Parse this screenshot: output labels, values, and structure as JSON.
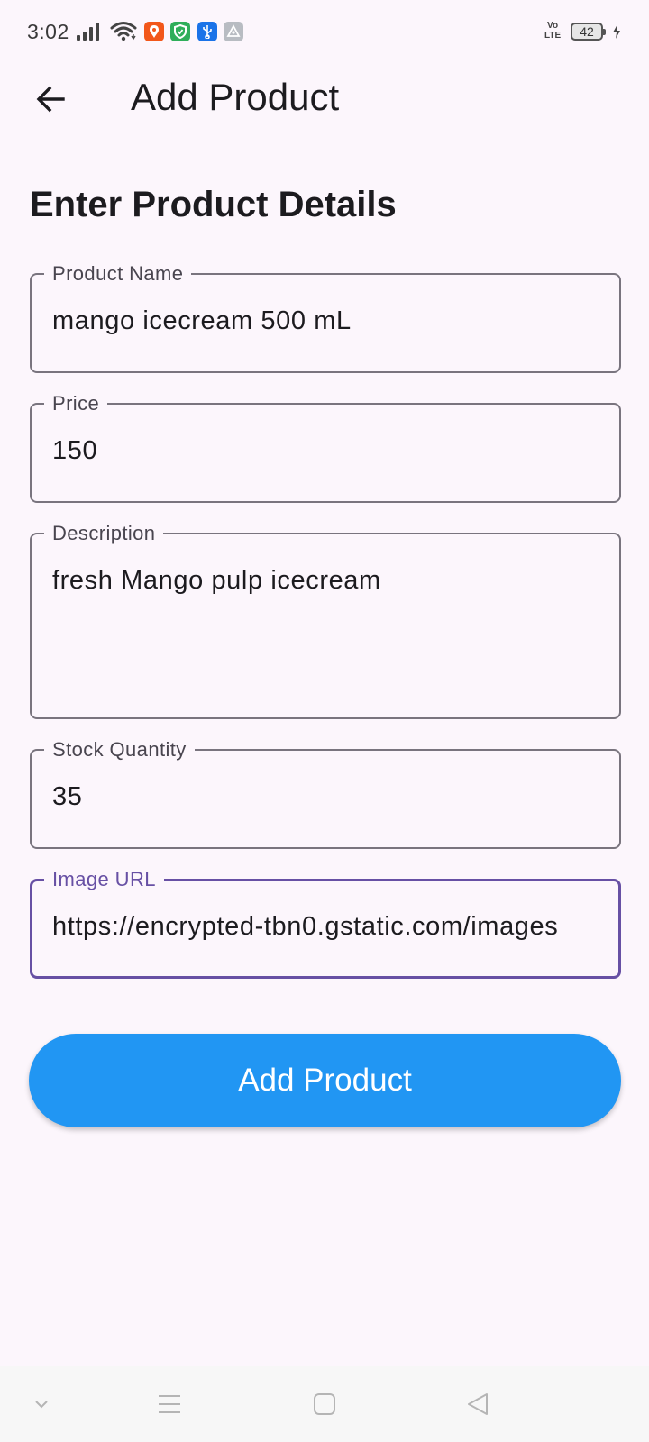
{
  "status_bar": {
    "time": "3:02",
    "battery_level": "42",
    "network_label_top": "Vo",
    "network_label_bottom": "LTE",
    "icons": [
      "signal-icon",
      "wifi-icon",
      "app-notification-orange-icon",
      "app-notification-green-shield-icon",
      "usb-icon",
      "app-notification-grey-icon",
      "charging-icon"
    ]
  },
  "app_bar": {
    "title": "Add Product",
    "back_icon": "arrow-back-icon"
  },
  "form": {
    "heading": "Enter Product Details",
    "fields": [
      {
        "label": "Product Name",
        "value": "mango icecream 500 mL"
      },
      {
        "label": "Price",
        "value": "150"
      },
      {
        "label": "Description",
        "value": "fresh Mango pulp icecream"
      },
      {
        "label": "Stock Quantity",
        "value": "35"
      },
      {
        "label": "Image URL",
        "value": "https://encrypted-tbn0.gstatic.com/images"
      }
    ],
    "submit_label": "Add Product"
  },
  "colors": {
    "background": "#fcf6fc",
    "outline": "#79747e",
    "focus": "#6750a4",
    "button": "#2196f3",
    "button_text": "#ffffff"
  },
  "nav_bar": {
    "icons": [
      "chevron-down-icon",
      "menu-icon",
      "home-square-icon",
      "back-triangle-icon"
    ]
  }
}
